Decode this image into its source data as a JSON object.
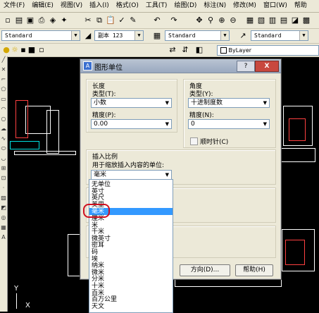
{
  "menubar": [
    "文件(F)",
    "编辑(E)",
    "视图(V)",
    "插入(I)",
    "格式(O)",
    "工具(T)",
    "绘图(D)",
    "标注(N)",
    "修改(M)",
    "窗口(W)",
    "帮助"
  ],
  "toolbar2": {
    "style1": "Standard",
    "copy_label": "副本 123",
    "style2": "Standard",
    "style3": "Standard"
  },
  "toolbar3": {
    "bylayer": "ByLayer"
  },
  "dialog": {
    "title": "图形单位",
    "help": "?",
    "close": "X",
    "length": {
      "heading": "长度",
      "type_label": "类型(T):",
      "type_value": "小数",
      "precision_label": "精度(P):",
      "precision_value": "0.00"
    },
    "angle": {
      "heading": "角度",
      "type_label": "类型(Y):",
      "type_value": "十进制度数",
      "precision_label": "精度(N):",
      "precision_value": "0",
      "clockwise_label": "顺时针(C)"
    },
    "insert": {
      "heading": "插入比例",
      "desc": "用于缩放插入内容的单位:",
      "value": "毫米"
    },
    "buttons": {
      "direction": "方向(D)...",
      "help": "帮助(H)"
    }
  },
  "unit_options": [
    "无单位",
    "英寸",
    "英尺",
    "英里",
    "毫米",
    "厘米",
    "米",
    "千米",
    "微英寸",
    "密耳",
    "码",
    "埃",
    "纳米",
    "微米",
    "分米",
    "十米",
    "百米",
    "百万公里",
    "天文"
  ],
  "selected_unit": "毫米",
  "axis": {
    "y": "Y",
    "x": "X"
  }
}
